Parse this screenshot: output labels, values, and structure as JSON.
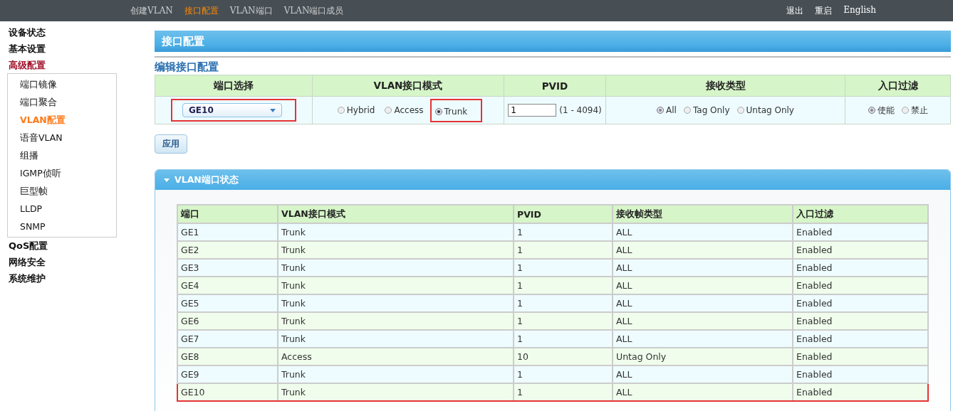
{
  "top_nav": {
    "items": [
      {
        "label": "创建VLAN",
        "selected": false
      },
      {
        "label": "接口配置",
        "selected": true
      },
      {
        "label": "VLAN端口",
        "selected": false
      },
      {
        "label": "VLAN端口成员",
        "selected": false
      }
    ],
    "actions": [
      "退出",
      "重启",
      "English"
    ]
  },
  "sidebar": {
    "items": [
      {
        "label": "设备状态",
        "expanded": false
      },
      {
        "label": "基本设置",
        "expanded": false
      },
      {
        "label": "高级配置",
        "expanded": true,
        "children": [
          {
            "label": "端口镜像",
            "selected": false
          },
          {
            "label": "端口聚合",
            "selected": false
          },
          {
            "label": "VLAN配置",
            "selected": true
          },
          {
            "label": "语音VLAN",
            "selected": false
          },
          {
            "label": "组播",
            "selected": false
          },
          {
            "label": "IGMP侦听",
            "selected": false
          },
          {
            "label": "巨型帧",
            "selected": false
          },
          {
            "label": "LLDP",
            "selected": false
          },
          {
            "label": "SNMP",
            "selected": false
          }
        ]
      },
      {
        "label": "QoS配置",
        "expanded": false
      },
      {
        "label": "网络安全",
        "expanded": false
      },
      {
        "label": "系统维护",
        "expanded": false
      }
    ]
  },
  "page_title": "接口配置",
  "edit": {
    "title": "编辑接口配置",
    "columns": [
      "端口选择",
      "VLAN接口模式",
      "PVID",
      "接收类型",
      "入口过滤"
    ],
    "port_select": {
      "value": "GE10",
      "highlighted": true
    },
    "modes": [
      {
        "label": "Hybrid",
        "selected": false,
        "highlighted": false
      },
      {
        "label": "Access",
        "selected": false,
        "highlighted": false
      },
      {
        "label": "Trunk",
        "selected": true,
        "highlighted": true
      }
    ],
    "pvid": {
      "value": "1",
      "range": "(1 - 4094)"
    },
    "accept": [
      {
        "label": "All",
        "selected": true
      },
      {
        "label": "Tag Only",
        "selected": false
      },
      {
        "label": "Untag Only",
        "selected": false
      }
    ],
    "filter": [
      {
        "label": "使能",
        "selected": true
      },
      {
        "label": "禁止",
        "selected": false
      }
    ],
    "apply_button": "应用"
  },
  "status_panel": {
    "title": "VLAN端口状态",
    "expanded": true,
    "columns": [
      "端口",
      "VLAN接口模式",
      "PVID",
      "接收帧类型",
      "入口过滤"
    ],
    "rows": [
      {
        "cells": [
          "GE1",
          "Trunk",
          "1",
          "ALL",
          "Enabled"
        ],
        "highlighted": false
      },
      {
        "cells": [
          "GE2",
          "Trunk",
          "1",
          "ALL",
          "Enabled"
        ],
        "highlighted": false
      },
      {
        "cells": [
          "GE3",
          "Trunk",
          "1",
          "ALL",
          "Enabled"
        ],
        "highlighted": false
      },
      {
        "cells": [
          "GE4",
          "Trunk",
          "1",
          "ALL",
          "Enabled"
        ],
        "highlighted": false
      },
      {
        "cells": [
          "GE5",
          "Trunk",
          "1",
          "ALL",
          "Enabled"
        ],
        "highlighted": false
      },
      {
        "cells": [
          "GE6",
          "Trunk",
          "1",
          "ALL",
          "Enabled"
        ],
        "highlighted": false
      },
      {
        "cells": [
          "GE7",
          "Trunk",
          "1",
          "ALL",
          "Enabled"
        ],
        "highlighted": false
      },
      {
        "cells": [
          "GE8",
          "Access",
          "10",
          "Untag Only",
          "Enabled"
        ],
        "highlighted": false
      },
      {
        "cells": [
          "GE9",
          "Trunk",
          "1",
          "ALL",
          "Enabled"
        ],
        "highlighted": false
      },
      {
        "cells": [
          "GE10",
          "Trunk",
          "1",
          "ALL",
          "Enabled"
        ],
        "highlighted": true
      }
    ]
  }
}
